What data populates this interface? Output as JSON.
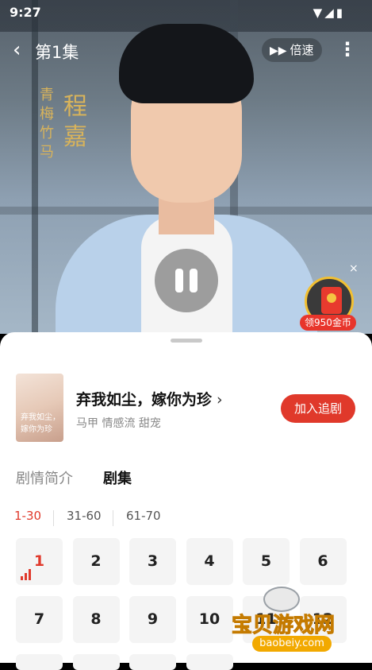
{
  "status_bar": {
    "time": "9:27",
    "icons": "▼◢▮"
  },
  "player": {
    "back_icon": "‹",
    "episode_title": "第1集",
    "speed_label": "倍速",
    "more_icon": "⋮",
    "poster_small_text": "青梅竹马",
    "poster_big_text": "程嘉"
  },
  "reward": {
    "close_icon": "×",
    "label": "领950金币"
  },
  "show": {
    "cover_text": "弃我如尘，嫁你为珍",
    "title": "弃我如尘，嫁你为珍",
    "chevron": "›",
    "tags": "马甲 情感流 甜宠",
    "follow_label": "加入追剧"
  },
  "tabs": {
    "intro": "剧情简介",
    "episodes": "剧集"
  },
  "ranges": [
    "1-30",
    "31-60",
    "61-70"
  ],
  "active_range": "1-30",
  "episodes": [
    "1",
    "2",
    "3",
    "4",
    "5",
    "6",
    "7",
    "8",
    "9",
    "10",
    "11",
    "12"
  ],
  "current_episode": "1",
  "watermark": {
    "text": "宝贝游戏网",
    "url": "baobeiy.com"
  },
  "colors": {
    "accent": "#e0392b",
    "coin_gold": "#f2c032"
  }
}
